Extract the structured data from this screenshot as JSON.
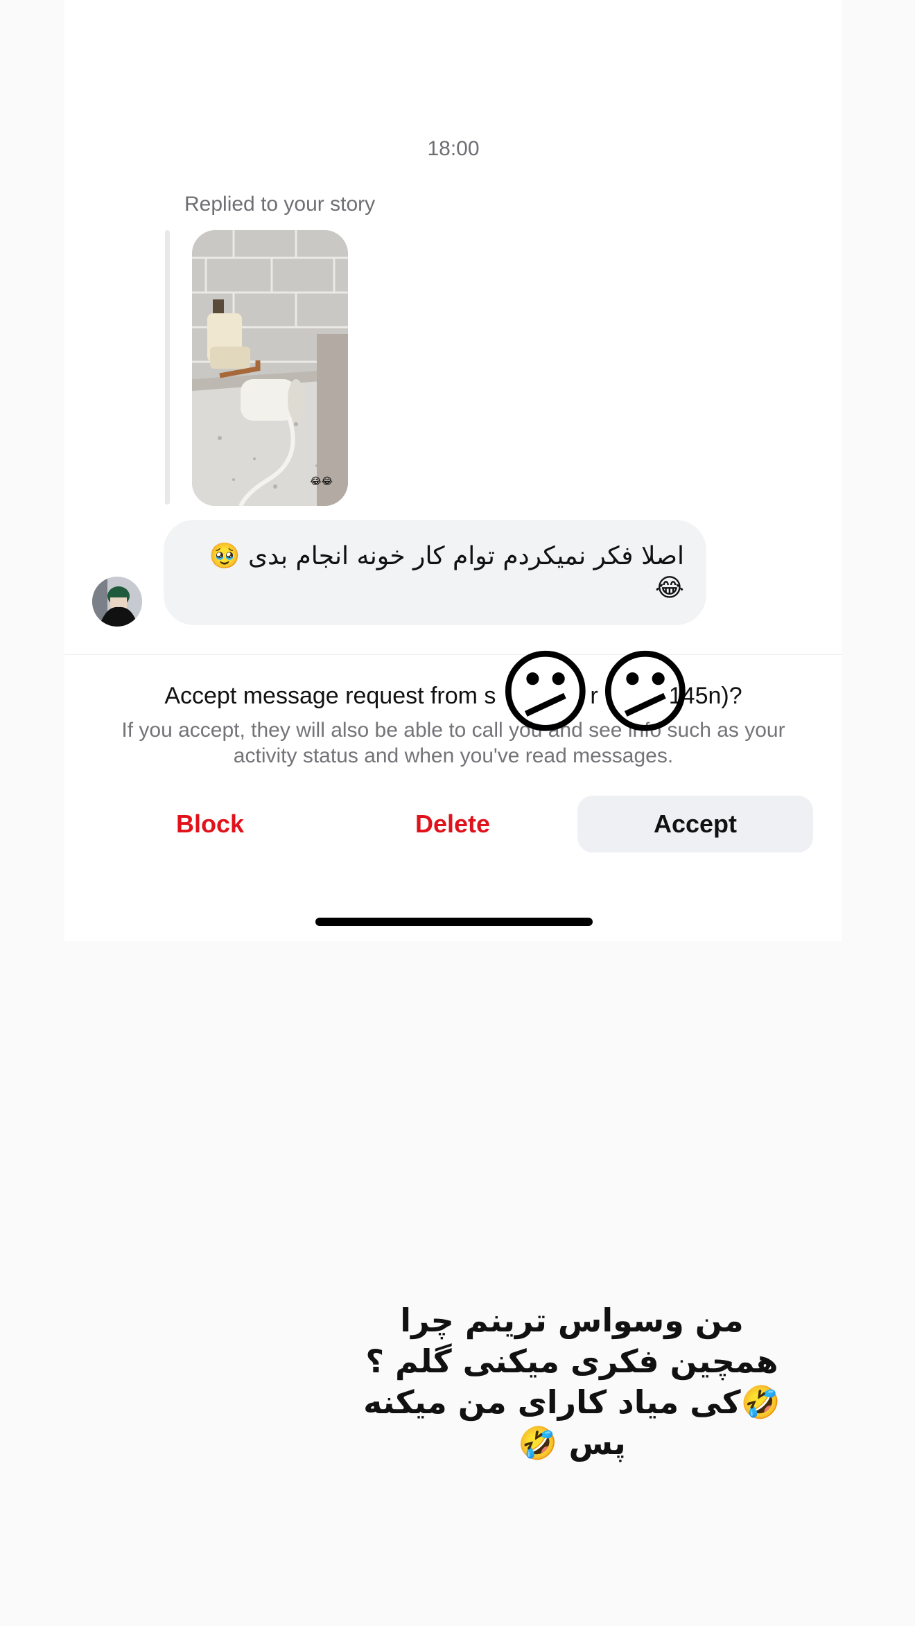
{
  "chat": {
    "timestamp": "18:00",
    "reply_context": "Replied to your story",
    "story_thumb_emojis": "😂😂",
    "message_text": "اصلا فکر نمیکردم توام کار خونه انجام بدی 🥹 😂"
  },
  "request": {
    "title": "Accept message request from s    r   145n)?",
    "subtitle": "If you accept, they will also be able to call you and see info such as your activity status and when you've read messages.",
    "block_label": "Block",
    "delete_label": "Delete",
    "accept_label": "Accept"
  },
  "overlay": {
    "stickers": [
      "😕",
      "😕"
    ],
    "caption": "من وسواس ترینم چرا همچین فکری میکنی گلم ؟🤣کی میاد کارای من میکنه پس 🤣"
  },
  "colors": {
    "destructive": "#e0121b",
    "accept_bg": "#eff0f3",
    "bubble_bg": "#f2f3f5",
    "secondary_text": "#6e6e73"
  }
}
